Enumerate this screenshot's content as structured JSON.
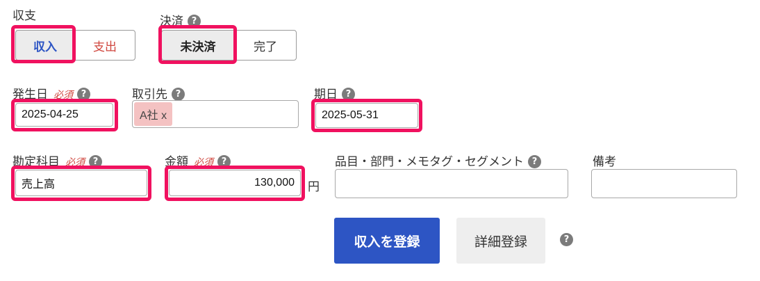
{
  "type_group": {
    "label": "収支",
    "options": [
      "収入",
      "支出"
    ],
    "selected": "収入"
  },
  "settlement_group": {
    "label": "決済",
    "options": [
      "未決済",
      "完了"
    ],
    "selected": "未決済"
  },
  "required_text": "必須",
  "help_glyph": "?",
  "occurrence_date": {
    "label": "発生日",
    "value": "2025-04-25"
  },
  "partner": {
    "label": "取引先",
    "tag_text": "A社 x"
  },
  "due_date": {
    "label": "期日",
    "value": "2025-05-31"
  },
  "account_item": {
    "label": "勘定科目",
    "value": "売上高"
  },
  "amount": {
    "label": "金額",
    "value": "130,000",
    "unit": "円"
  },
  "items_dept": {
    "label": "品目・部門・メモタグ・セグメント",
    "value": ""
  },
  "remarks": {
    "label": "備考",
    "value": ""
  },
  "register_button": "収入を登録",
  "detail_button": "詳細登録",
  "colors": {
    "primary": "#2d55c4",
    "highlight": "#f0115f",
    "income_text": "#2d55c4",
    "expense_text": "#d0473f",
    "required": "#d0473f",
    "tag_bg": "#f4c2c2"
  }
}
